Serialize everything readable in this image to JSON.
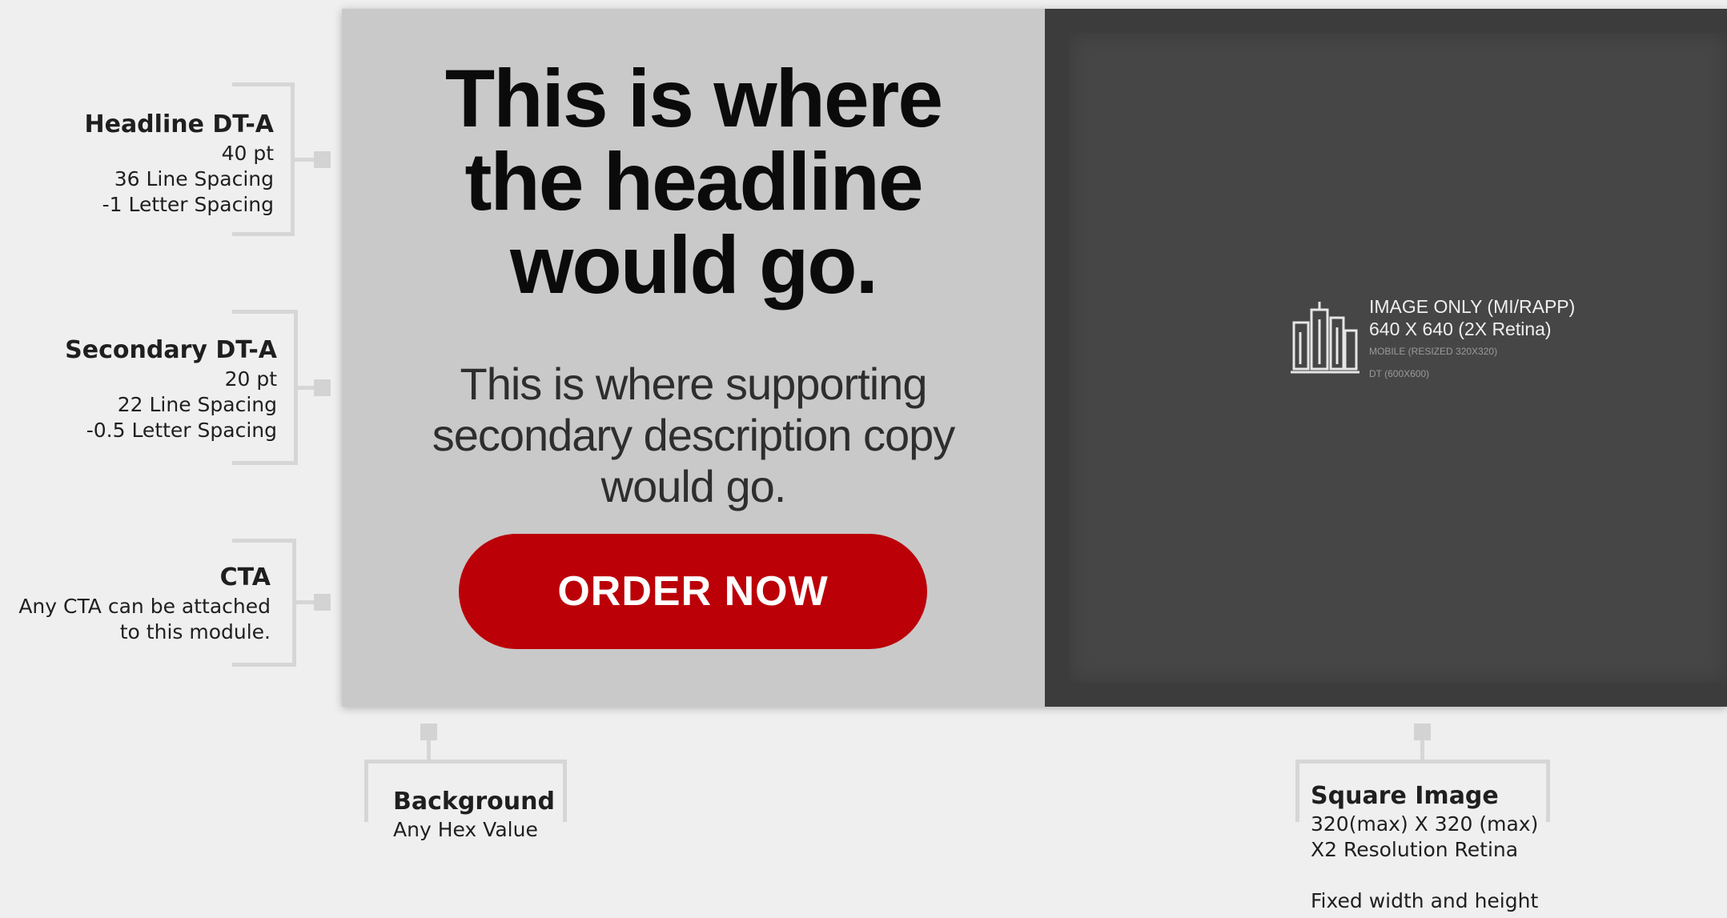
{
  "annotations": {
    "headline": {
      "title": "Headline DT-A",
      "lines": [
        "40 pt",
        "36 Line Spacing",
        "-1 Letter Spacing"
      ]
    },
    "secondary": {
      "title": "Secondary DT-A",
      "lines": [
        "20 pt",
        "22 Line Spacing",
        "-0.5 Letter Spacing"
      ]
    },
    "cta": {
      "title": "CTA",
      "lines": [
        "Any CTA can be attached",
        "to this module."
      ]
    },
    "background": {
      "title": "Background",
      "lines": [
        "Any Hex Value"
      ]
    },
    "square_image": {
      "title": "Square Image",
      "lines": [
        "320(max) X 320 (max)",
        "X2 Resolution Retina",
        "Fixed width and height"
      ]
    }
  },
  "module": {
    "headline_lines": [
      "This is where",
      "the headline",
      "would go."
    ],
    "secondary_lines": [
      "This is where supporting",
      "secondary description copy",
      "would go."
    ],
    "cta_label": "ORDER NOW",
    "image_placeholder": {
      "icon": "buildings-icon",
      "lines": [
        "IMAGE ONLY (MI/RAPP)",
        "640 X 640 (2X Retina)",
        "MOBILE (RESIZED 320X320)",
        "DT (600X600)"
      ]
    }
  },
  "colors": {
    "page_bg": "#efefef",
    "text_panel_bg": "#c9c9c9",
    "image_panel_bg": "#3c3c3c",
    "cta_bg": "#bb0008",
    "bracket": "#d6d6d6"
  }
}
